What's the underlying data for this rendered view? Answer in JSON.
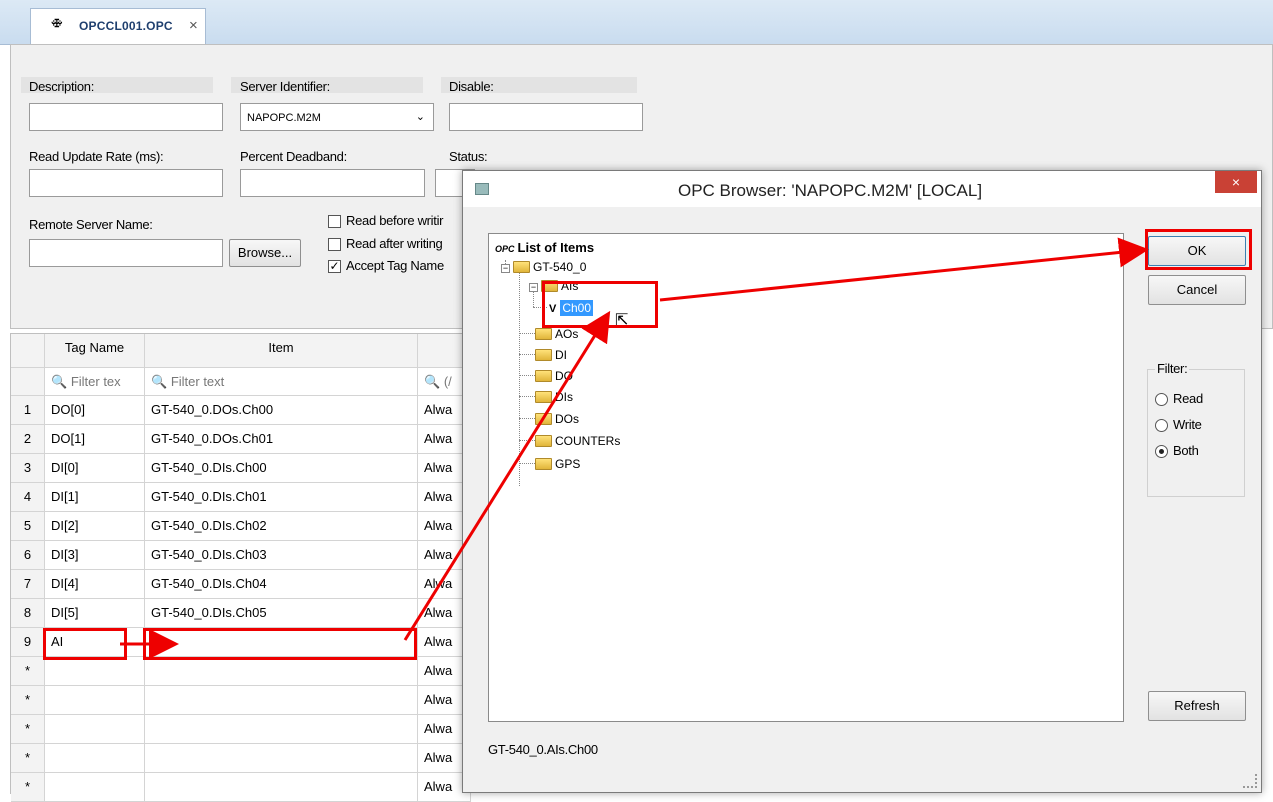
{
  "tab": {
    "icon": "ꗾ",
    "title": "OPCCL001.OPC",
    "close": "×"
  },
  "form": {
    "description_label": "Description:",
    "server_identifier_label": "Server Identifier:",
    "server_identifier_value": "NAPOPC.M2M",
    "disable_label": "Disable:",
    "read_update_rate_label": "Read Update Rate (ms):",
    "percent_deadband_label": "Percent Deadband:",
    "status_label": "Status:",
    "remote_server_label": "Remote Server Name:",
    "browse_button": "Browse...",
    "read_before_writing": "Read before writir",
    "read_after_writing": "Read after writing",
    "accept_tag_name": "Accept Tag Name"
  },
  "grid": {
    "headers": {
      "tag_name": "Tag Name",
      "item": "Item"
    },
    "filter_text": "Filter tex",
    "filter_text_full": "Filter text",
    "filter_third": "(/",
    "rows": [
      {
        "n": "1",
        "tag": "DO[0]",
        "item": "GT-540_0.DOs.Ch00",
        "c3": "Alwa"
      },
      {
        "n": "2",
        "tag": "DO[1]",
        "item": "GT-540_0.DOs.Ch01",
        "c3": "Alwa"
      },
      {
        "n": "3",
        "tag": "DI[0]",
        "item": "GT-540_0.DIs.Ch00",
        "c3": "Alwa"
      },
      {
        "n": "4",
        "tag": "DI[1]",
        "item": "GT-540_0.DIs.Ch01",
        "c3": "Alwa"
      },
      {
        "n": "5",
        "tag": "DI[2]",
        "item": "GT-540_0.DIs.Ch02",
        "c3": "Alwa"
      },
      {
        "n": "6",
        "tag": "DI[3]",
        "item": "GT-540_0.DIs.Ch03",
        "c3": "Alwa"
      },
      {
        "n": "7",
        "tag": "DI[4]",
        "item": "GT-540_0.DIs.Ch04",
        "c3": "Alwa"
      },
      {
        "n": "8",
        "tag": "DI[5]",
        "item": "GT-540_0.DIs.Ch05",
        "c3": "Alwa"
      },
      {
        "n": "9",
        "tag": "AI",
        "item": "",
        "c3": "Alwa"
      },
      {
        "n": "*",
        "tag": "",
        "item": "",
        "c3": "Alwa"
      },
      {
        "n": "*",
        "tag": "",
        "item": "",
        "c3": "Alwa"
      },
      {
        "n": "*",
        "tag": "",
        "item": "",
        "c3": "Alwa"
      },
      {
        "n": "*",
        "tag": "",
        "item": "",
        "c3": "Alwa"
      },
      {
        "n": "*",
        "tag": "",
        "item": "",
        "c3": "Alwa"
      }
    ]
  },
  "dialog": {
    "title": "OPC Browser: 'NAPOPC.M2M' [LOCAL]",
    "close": "×",
    "tree_root": "List of Items",
    "tree_root_icon": "OPC",
    "device": "GT-540_0",
    "nodes": {
      "ais": "AIs",
      "ch00": "Ch00",
      "aos": "AOs",
      "di": "DI",
      "do": "DO",
      "dis": "DIs",
      "dos": "DOs",
      "counters": "COUNTERs",
      "gps": "GPS"
    },
    "v_label": "V",
    "ok": "OK",
    "cancel": "Cancel",
    "filter_label": "Filter:",
    "filter_options": [
      "Read",
      "Write",
      "Both"
    ],
    "filter_selected": "Both",
    "refresh": "Refresh",
    "selected_path": "GT-540_0.AIs.Ch00"
  },
  "colors": {
    "annotation_red": "#e00000",
    "selection_blue": "#3399ff",
    "title_close_red": "#c94135"
  }
}
